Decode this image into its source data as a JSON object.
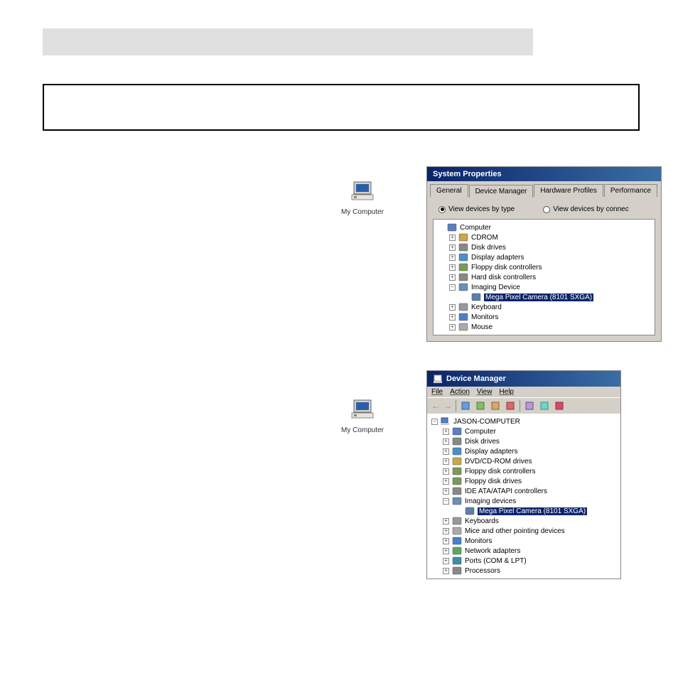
{
  "mycomputer_label": "My Computer",
  "sysprops": {
    "title": "System Properties",
    "tabs": [
      "General",
      "Device Manager",
      "Hardware Profiles",
      "Performance"
    ],
    "radio1": "View devices by type",
    "radio2": "View devices by connec",
    "tree": [
      {
        "exp": "",
        "icon": "computer",
        "label": "Computer",
        "level": 0
      },
      {
        "exp": "+",
        "icon": "cdrom",
        "label": "CDROM",
        "level": 1
      },
      {
        "exp": "+",
        "icon": "disk",
        "label": "Disk drives",
        "level": 1
      },
      {
        "exp": "+",
        "icon": "display",
        "label": "Display adapters",
        "level": 1
      },
      {
        "exp": "+",
        "icon": "floppy",
        "label": "Floppy disk controllers",
        "level": 1
      },
      {
        "exp": "+",
        "icon": "hdc",
        "label": "Hard disk controllers",
        "level": 1
      },
      {
        "exp": "-",
        "icon": "imaging",
        "label": "Imaging Device",
        "level": 1
      },
      {
        "exp": "",
        "icon": "camera",
        "label": "Mega Pixel Camera (8101 SXGA)",
        "level": 2,
        "hl": true
      },
      {
        "exp": "+",
        "icon": "keyboard",
        "label": "Keyboard",
        "level": 1
      },
      {
        "exp": "+",
        "icon": "monitor",
        "label": "Monitors",
        "level": 1
      },
      {
        "exp": "+",
        "icon": "mouse",
        "label": "Mouse",
        "level": 1
      }
    ]
  },
  "devmgr": {
    "title": "Device Manager",
    "menu": [
      "File",
      "Action",
      "View",
      "Help"
    ],
    "root": "JASON-COMPUTER",
    "tree": [
      {
        "exp": "+",
        "icon": "computer",
        "label": "Computer",
        "level": 1
      },
      {
        "exp": "+",
        "icon": "disk",
        "label": "Disk drives",
        "level": 1
      },
      {
        "exp": "+",
        "icon": "display",
        "label": "Display adapters",
        "level": 1
      },
      {
        "exp": "+",
        "icon": "dvd",
        "label": "DVD/CD-ROM drives",
        "level": 1
      },
      {
        "exp": "+",
        "icon": "floppy",
        "label": "Floppy disk controllers",
        "level": 1
      },
      {
        "exp": "+",
        "icon": "floppy",
        "label": "Floppy disk drives",
        "level": 1
      },
      {
        "exp": "+",
        "icon": "ide",
        "label": "IDE ATA/ATAPI controllers",
        "level": 1
      },
      {
        "exp": "-",
        "icon": "imaging",
        "label": "Imaging devices",
        "level": 1
      },
      {
        "exp": "",
        "icon": "camera",
        "label": "Mega Pixel Camera (8101 SXGA)",
        "level": 2,
        "hl": true
      },
      {
        "exp": "+",
        "icon": "keyboard",
        "label": "Keyboards",
        "level": 1
      },
      {
        "exp": "+",
        "icon": "mouse",
        "label": "Mice and other pointing devices",
        "level": 1
      },
      {
        "exp": "+",
        "icon": "monitor",
        "label": "Monitors",
        "level": 1
      },
      {
        "exp": "+",
        "icon": "network",
        "label": "Network adapters",
        "level": 1
      },
      {
        "exp": "+",
        "icon": "ports",
        "label": "Ports (COM & LPT)",
        "level": 1
      },
      {
        "exp": "+",
        "icon": "processor",
        "label": "Processors",
        "level": 1
      }
    ]
  }
}
